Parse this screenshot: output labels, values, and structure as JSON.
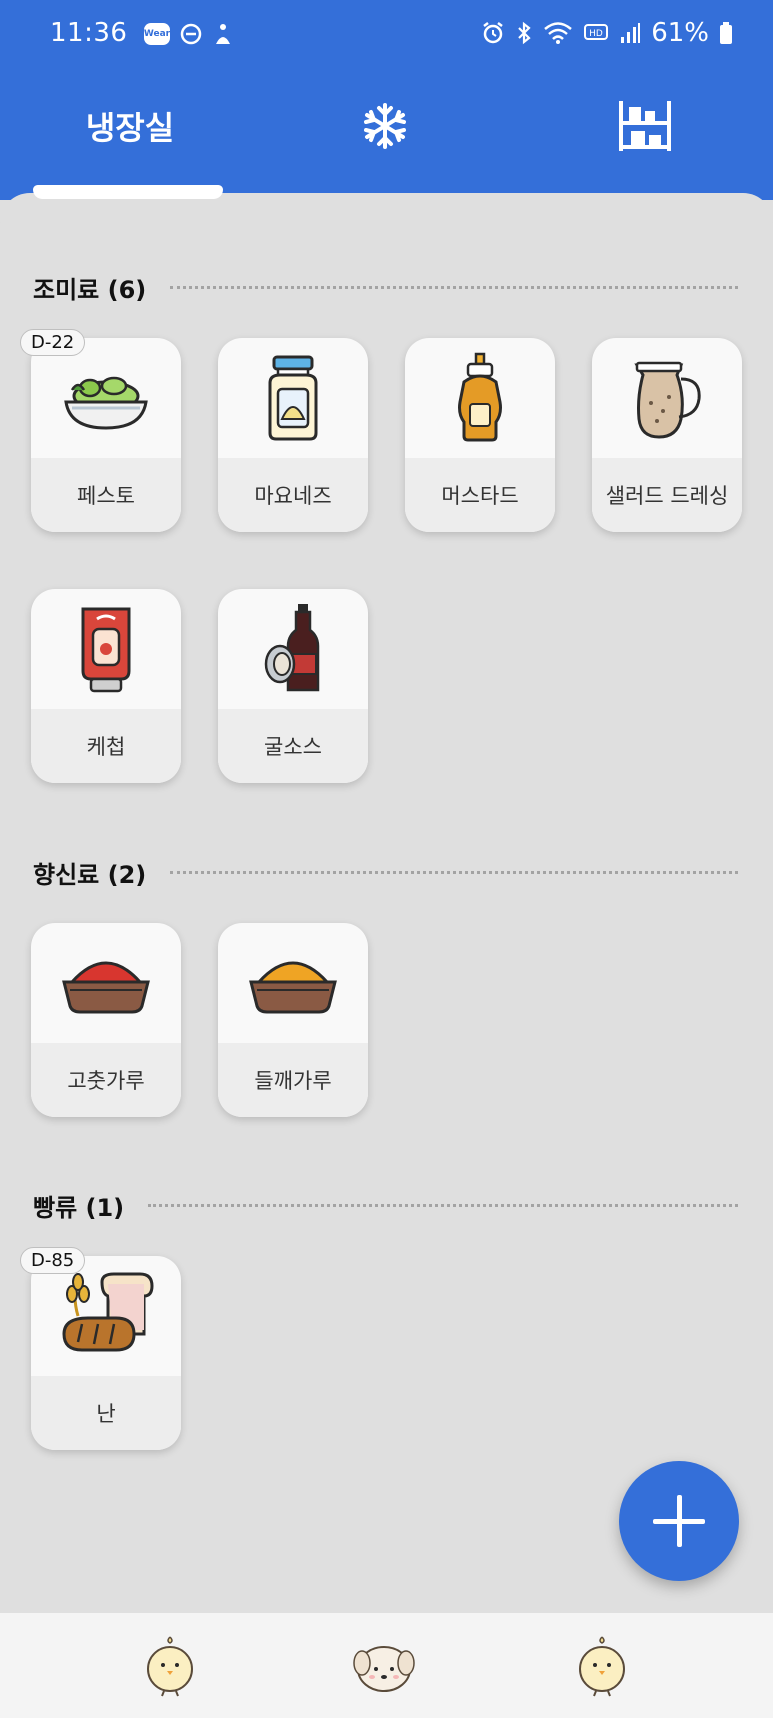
{
  "status_bar": {
    "time": "11:36",
    "wear_badge": "Wear",
    "battery_percent": "61%"
  },
  "tabs": [
    {
      "label": "냉장실",
      "icon": "fridge-tab",
      "selected": true
    },
    {
      "label": "",
      "icon": "snowflake-icon",
      "selected": false
    },
    {
      "label": "",
      "icon": "shelf-icon",
      "selected": false
    }
  ],
  "sections": [
    {
      "title": "조미료 (6)",
      "items": [
        {
          "label": "페스토",
          "badge": "D-22",
          "icon": "pesto-bowl-icon"
        },
        {
          "label": "마요네즈",
          "badge": "",
          "icon": "mayonnaise-jar-icon"
        },
        {
          "label": "머스타드",
          "badge": "",
          "icon": "mustard-bottle-icon"
        },
        {
          "label": "샐러드 드레싱",
          "badge": "",
          "icon": "dressing-pitcher-icon"
        },
        {
          "label": "케첩",
          "badge": "",
          "icon": "ketchup-bottle-icon"
        },
        {
          "label": "굴소스",
          "badge": "",
          "icon": "oyster-sauce-icon"
        }
      ]
    },
    {
      "title": "향신료 (2)",
      "items": [
        {
          "label": "고춧가루",
          "badge": "",
          "icon": "chili-powder-icon"
        },
        {
          "label": "들깨가루",
          "badge": "",
          "icon": "perilla-powder-icon"
        }
      ]
    },
    {
      "title": "빵류 (1)",
      "items": [
        {
          "label": "난",
          "badge": "D-85",
          "icon": "bread-icon"
        }
      ]
    }
  ],
  "bottom_nav": [
    {
      "icon": "chick-icon"
    },
    {
      "icon": "puppy-icon"
    },
    {
      "icon": "chick-icon"
    }
  ],
  "colors": {
    "primary": "#346fd9",
    "background": "#dfdfdf",
    "card": "#f9f9f9"
  }
}
